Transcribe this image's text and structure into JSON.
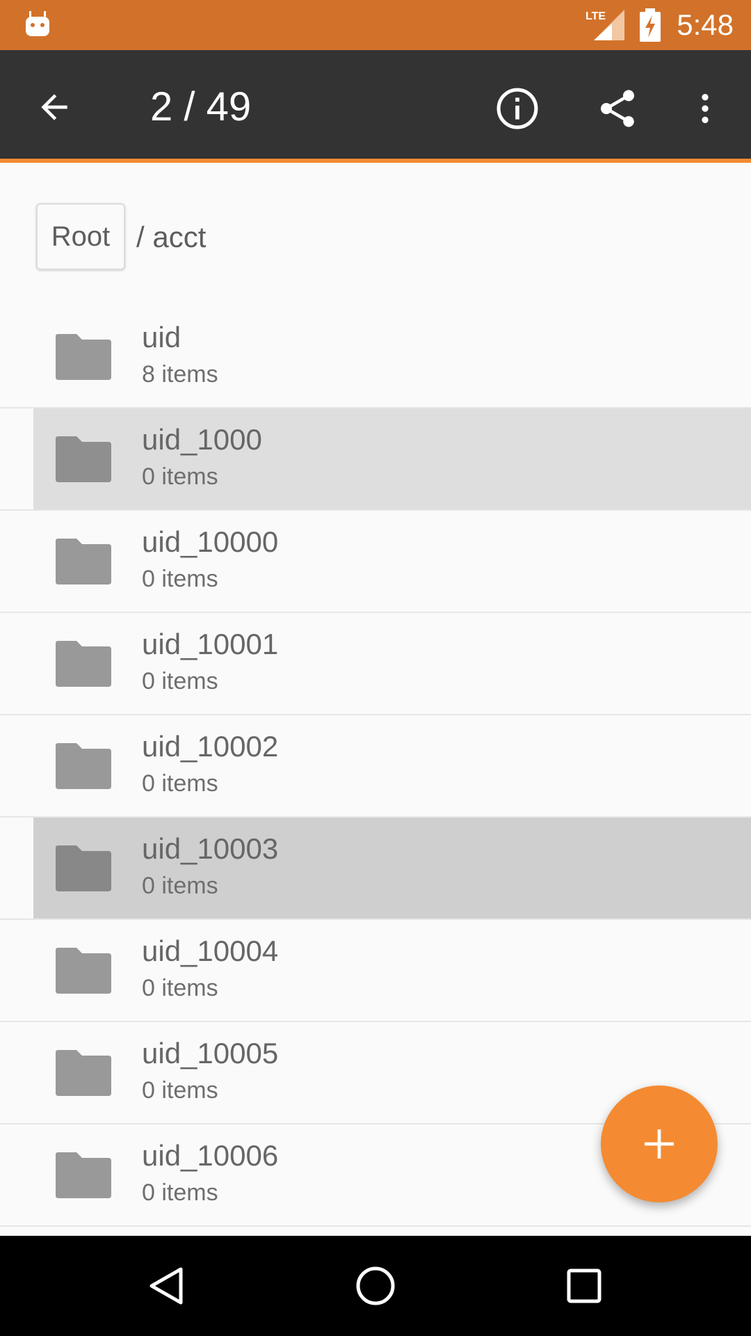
{
  "status_bar": {
    "time": "5:48",
    "network_label": "LTE",
    "color": "#d2722a"
  },
  "toolbar": {
    "title": "2 / 49",
    "back_icon": "arrow-back-icon",
    "info_icon": "info-icon",
    "share_icon": "share-icon",
    "more_icon": "more-vert-icon",
    "accent": "#f48b32"
  },
  "breadcrumb": {
    "root_label": "Root",
    "path": "/ acct"
  },
  "files": [
    {
      "name": "uid",
      "count": "8 items",
      "selected": ""
    },
    {
      "name": "uid_1000",
      "count": "0 items",
      "selected": "sel1"
    },
    {
      "name": "uid_10000",
      "count": "0 items",
      "selected": ""
    },
    {
      "name": "uid_10001",
      "count": "0 items",
      "selected": ""
    },
    {
      "name": "uid_10002",
      "count": "0 items",
      "selected": ""
    },
    {
      "name": "uid_10003",
      "count": "0 items",
      "selected": "sel2"
    },
    {
      "name": "uid_10004",
      "count": "0 items",
      "selected": ""
    },
    {
      "name": "uid_10005",
      "count": "0 items",
      "selected": ""
    },
    {
      "name": "uid_10006",
      "count": "0 items",
      "selected": ""
    }
  ],
  "fab": {
    "icon": "plus-icon",
    "color": "#f48b32"
  },
  "nav_bar": {
    "back_icon": "nav-back-icon",
    "home_icon": "nav-home-icon",
    "recents_icon": "nav-recents-icon"
  }
}
